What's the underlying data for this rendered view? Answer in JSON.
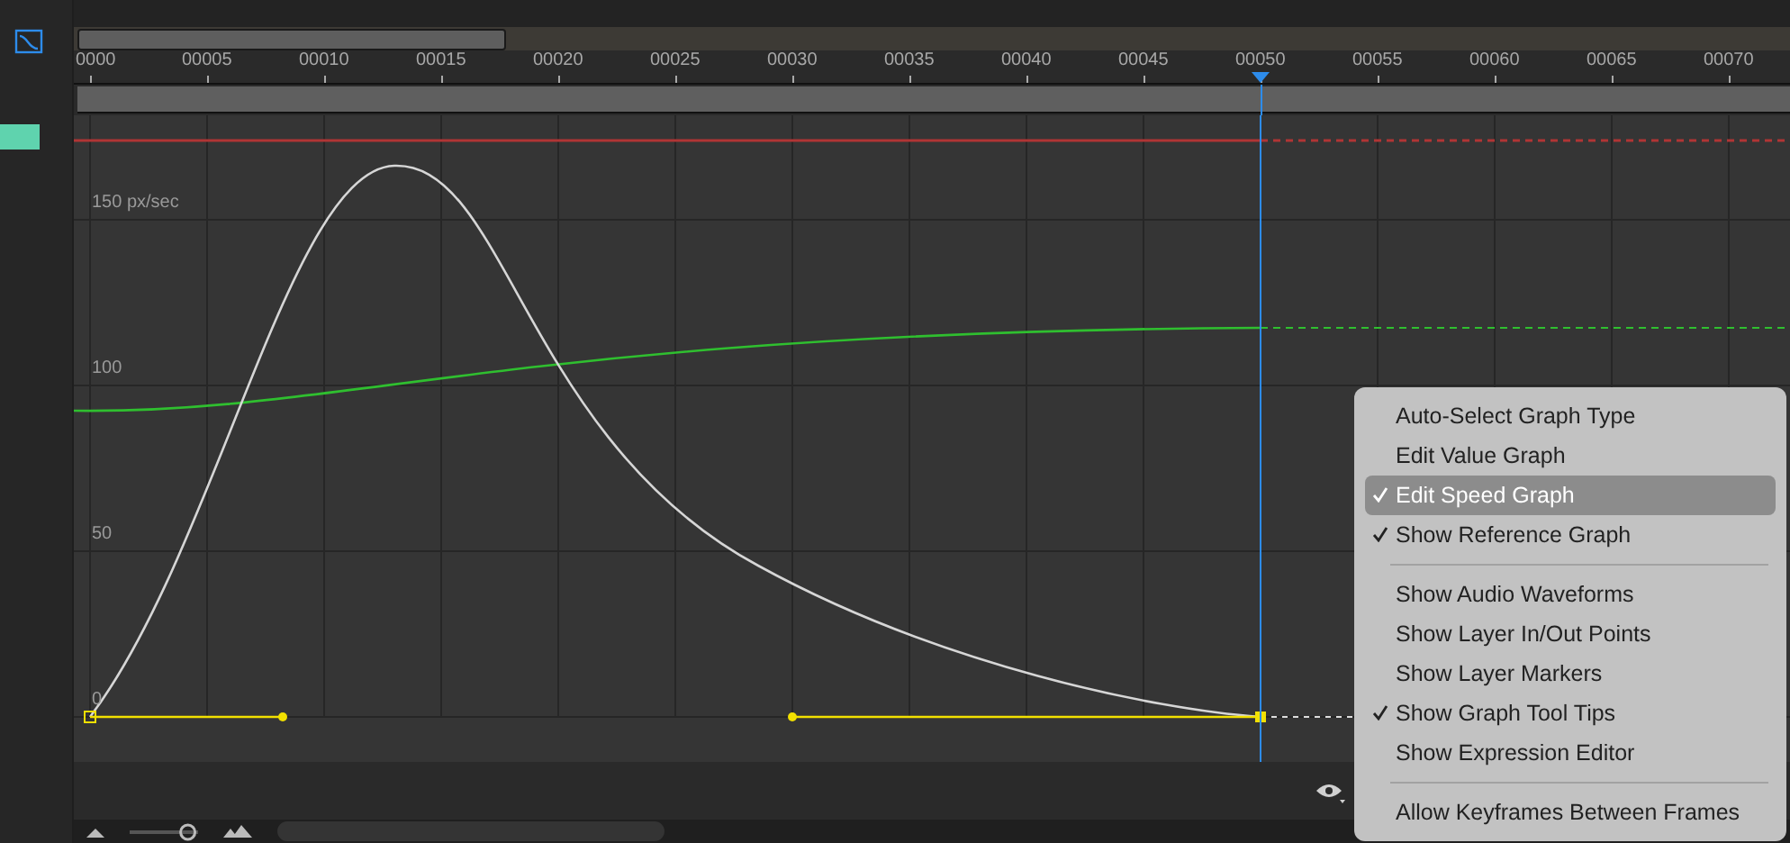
{
  "ruler": {
    "labels": [
      "0000",
      "00005",
      "00010",
      "00015",
      "00020",
      "00025",
      "00030",
      "00035",
      "00040",
      "00045",
      "00050",
      "00055",
      "00060",
      "00065",
      "00070"
    ]
  },
  "graph": {
    "y_labels": [
      "150 px/sec",
      "100",
      "50",
      "0"
    ]
  },
  "zoom": {
    "level": 0.85
  },
  "menu": {
    "items": [
      {
        "kind": "item",
        "label": "Auto-Select Graph Type",
        "checked": false,
        "selected": false
      },
      {
        "kind": "item",
        "label": "Edit Value Graph",
        "checked": false,
        "selected": false
      },
      {
        "kind": "item",
        "label": "Edit Speed Graph",
        "checked": true,
        "selected": true
      },
      {
        "kind": "item",
        "label": "Show Reference Graph",
        "checked": true,
        "selected": false
      },
      {
        "kind": "separator"
      },
      {
        "kind": "item",
        "label": "Show Audio Waveforms",
        "checked": false,
        "selected": false
      },
      {
        "kind": "item",
        "label": "Show Layer In/Out Points",
        "checked": false,
        "selected": false
      },
      {
        "kind": "item",
        "label": "Show Layer Markers",
        "checked": false,
        "selected": false
      },
      {
        "kind": "item",
        "label": "Show Graph Tool Tips",
        "checked": true,
        "selected": false
      },
      {
        "kind": "item",
        "label": "Show Expression Editor",
        "checked": false,
        "selected": false
      },
      {
        "kind": "separator"
      },
      {
        "kind": "item",
        "label": "Allow Keyframes Between Frames",
        "checked": false,
        "selected": false
      }
    ]
  }
}
